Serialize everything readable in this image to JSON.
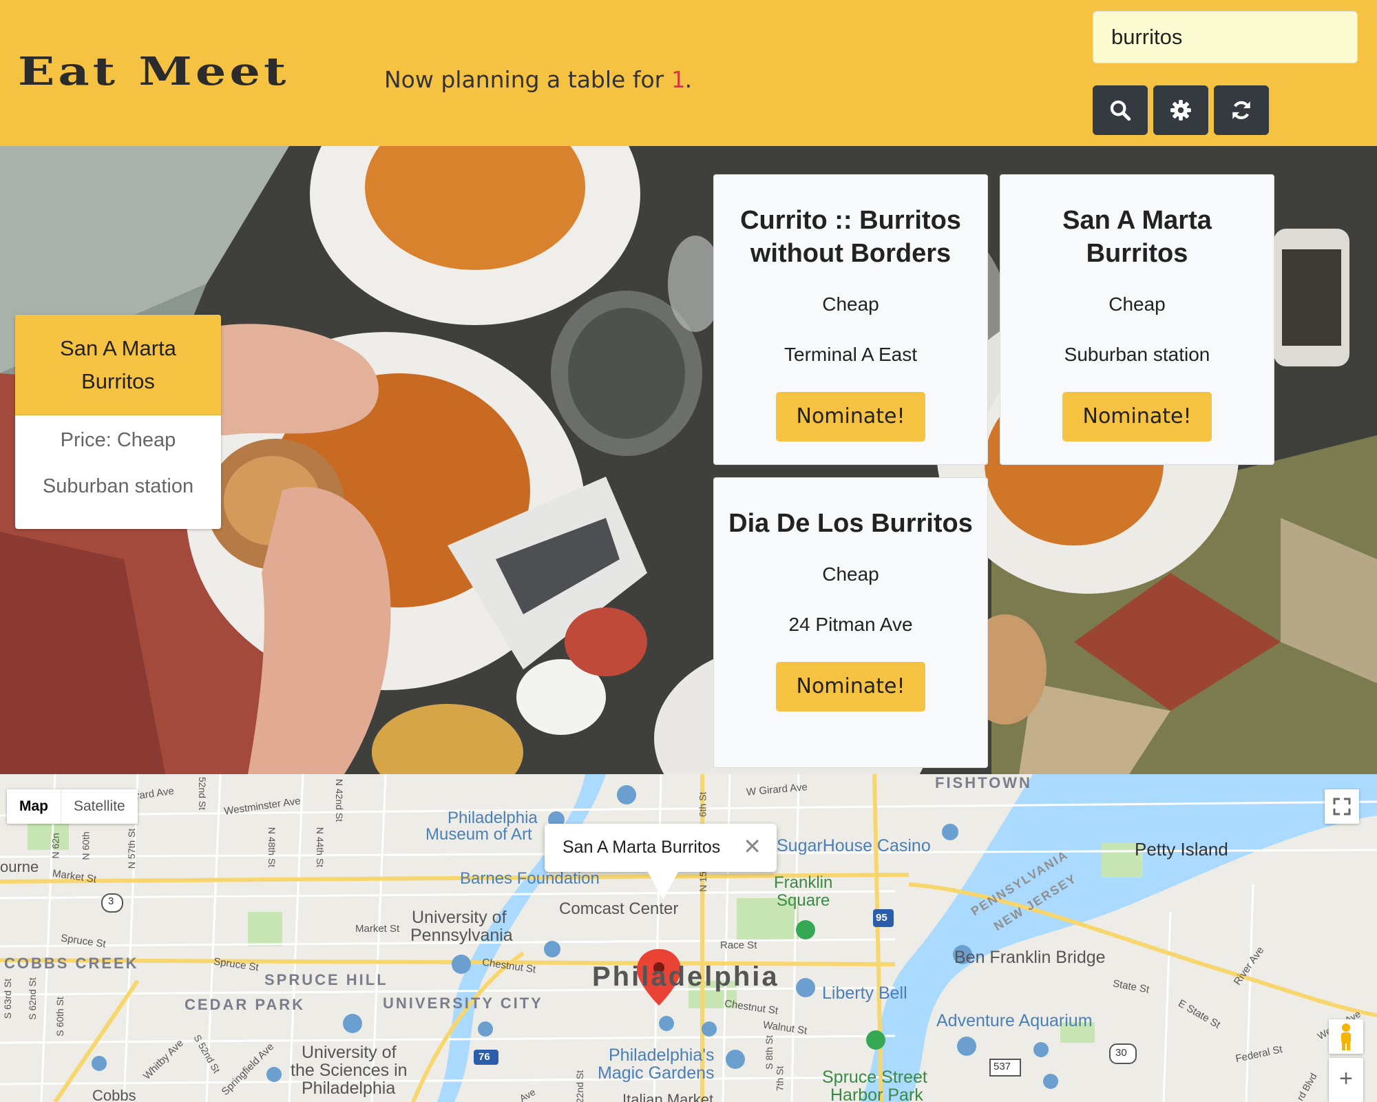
{
  "header": {
    "logo": "Eat Meet",
    "planning_prefix": "Now planning a table for ",
    "party_size": "1",
    "planning_suffix": ".",
    "search_value": "burritos"
  },
  "toolbar": {
    "search_icon": "search-icon",
    "settings_icon": "gear-icon",
    "refresh_icon": "refresh-icon"
  },
  "nominee": {
    "name": "San A Marta Burritos",
    "price": "Price: Cheap",
    "location": "Suburban station"
  },
  "results": [
    {
      "name": "Currito :: Burritos without Borders",
      "price": "Cheap",
      "address": "Terminal A East",
      "button": "Nominate!"
    },
    {
      "name": "San A Marta Burritos",
      "price": "Cheap",
      "address": "Suburban station",
      "button": "Nominate!"
    },
    {
      "name": "Dia De Los Burritos",
      "price": "Cheap",
      "address": "24 Pitman Ave",
      "button": "Nominate!"
    }
  ],
  "map": {
    "type_map": "Map",
    "type_satellite": "Satellite",
    "infowindow_title": "San A Marta Burritos",
    "infowindow_close": "✕",
    "zoom_in": "+",
    "city": "Philadelphia",
    "labels": {
      "fishtown": "FISHTOWN",
      "girard_w": "W Girard Ave",
      "girard_left": "irard Ave",
      "westminster": "Westminster Ave",
      "n52": "52nd St",
      "n42": "N 42nd St",
      "museum_1": "Philadelphia",
      "museum_2": "Museum of Art",
      "sugarhouse": "SugarHouse Casino",
      "petty": "Petty Island",
      "pennsylvania": "PENNSYLVANIA",
      "new_jersey": "NEW JERSEY",
      "barnes": "Barnes Foundation",
      "franklin_1": "Franklin",
      "franklin_2": "Square",
      "comcast": "Comcast Center",
      "upenn_1": "University of",
      "upenn_2": "Pennsylvania",
      "market_left": "Market St",
      "market_mid": "Market St",
      "race": "Race St",
      "ben_franklin": "Ben Franklin Bridge",
      "spruce_left": "Spruce St",
      "spruce_mid": "Spruce St",
      "chestnut": "Chestnut St",
      "chestnut_2": "Chestnut St",
      "walnut": "Walnut St",
      "cobbs": "COBBS CREEK",
      "spruce_hill": "SPRUCE HILL",
      "cedar_park": "CEDAR PARK",
      "university_city": "UNIVERSITY CITY",
      "liberty": "Liberty Bell",
      "adventure": "Adventure Aquarium",
      "state_st": "State St",
      "e_state": "E State St",
      "river_ave": "River Ave",
      "sciences_1": "University of",
      "sciences_2": "the Sciences in",
      "sciences_3": "Philadelphia",
      "magic_1": "Philadelphia's",
      "magic_2": "Magic Gardens",
      "italian": "Italian Market",
      "spruce_harbor_1": "Spruce Street",
      "spruce_harbor_2": "Harbor Park",
      "federal": "Federal St",
      "cobbs_bottom": "Cobbs",
      "ourne": "ourne",
      "whitby": "Whitby Ave",
      "springfield": "Springfield Ave",
      "n62": "N 62n",
      "n60": "N 60th",
      "n57": "N 57th St",
      "n48": "N 48th St",
      "n44": "N 44th St",
      "n15": "N 15",
      "n6": "6th St",
      "s63": "S 63rd St",
      "s62": "S 62nd St",
      "s60": "S 60th St",
      "s52": "S 52nd St",
      "s8": "S 8th St",
      "s7": "7th St",
      "s22": "22nd St",
      "ave_bottom": "Ave",
      "blvd": "rd Blvd",
      "wes_ave": "Wes  ld Ave",
      "rt3": "3",
      "rt95": "95",
      "rt76": "76",
      "rt30": "30",
      "rt537": "537"
    }
  }
}
